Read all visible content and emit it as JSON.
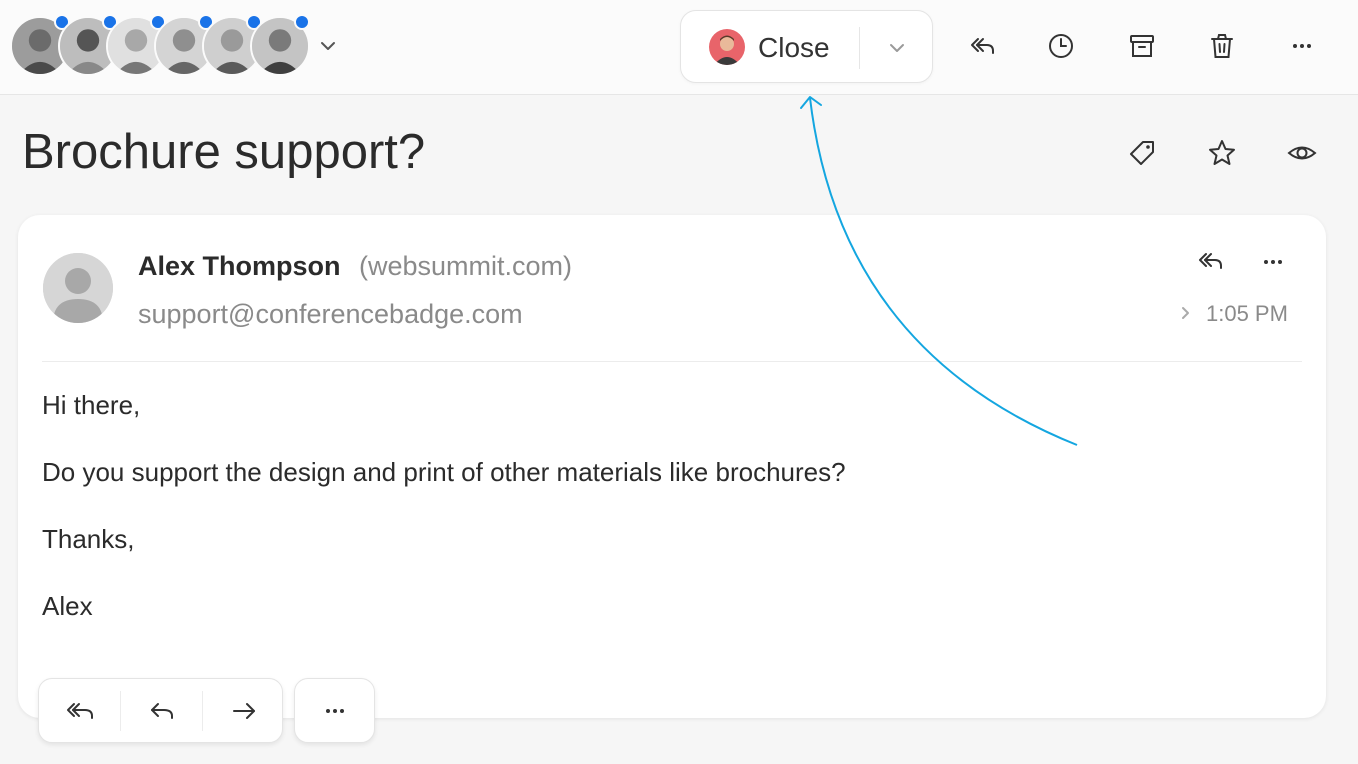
{
  "toolbar": {
    "close_label": "Close",
    "participants": [
      {
        "name": "participant-1",
        "unread": true
      },
      {
        "name": "participant-2",
        "unread": true
      },
      {
        "name": "participant-3",
        "unread": true
      },
      {
        "name": "participant-4",
        "unread": true
      },
      {
        "name": "participant-5",
        "unread": true
      },
      {
        "name": "participant-6",
        "unread": true
      }
    ],
    "icons": [
      "reply-all-icon",
      "clock-icon",
      "archive-icon",
      "trash-icon",
      "more-icon"
    ]
  },
  "thread": {
    "subject": "Brochure support?",
    "subject_icons": [
      "tag-icon",
      "star-icon",
      "eye-icon"
    ]
  },
  "message": {
    "sender_name": "Alex Thompson",
    "sender_domain": "(websummit.com)",
    "recipient": "support@conferencebadge.com",
    "time": "1:05 PM",
    "body": [
      "Hi there,",
      "Do you support the design and print of other materials like brochures?",
      "Thanks,",
      "Alex"
    ]
  },
  "message_actions": [
    "reply-all-icon",
    "reply-icon",
    "forward-icon",
    "more-icon"
  ],
  "colors": {
    "accent_dot": "#1a73e8",
    "annotation_arrow": "#14a6e0",
    "text_primary": "#2b2b2b",
    "text_secondary": "#8a8a8a"
  }
}
